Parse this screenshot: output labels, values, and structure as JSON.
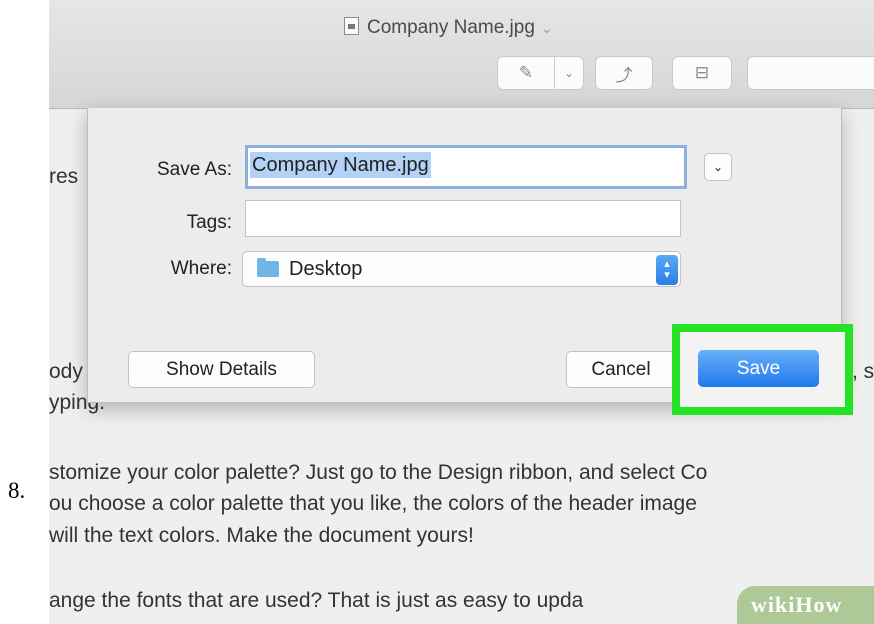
{
  "step_number": "8.",
  "window": {
    "title": "Company Name.jpg",
    "title_chevron": "⌄"
  },
  "toolbar": {
    "markup_icon": "pen-icon",
    "rotate_icon": "rotate-icon",
    "toolbox_icon": "toolbox-icon"
  },
  "document": {
    "fragment_1": "res",
    "fragment_2": "ody",
    "fragment_3": "yping.",
    "fragment_right": ", s",
    "para_lines": [
      "stomize your color palette?  Just go to the Design ribbon, and select Co",
      "ou choose a color palette that you like, the colors of the header image",
      " will the text colors.  Make the document yours!"
    ],
    "last_line": "ange the fonts that are used?  That is just as easy to upda"
  },
  "dialog": {
    "save_as_label": "Save As:",
    "save_as_value": "Company Name.jpg",
    "tags_label": "Tags:",
    "tags_value": "",
    "where_label": "Where:",
    "where_value": "Desktop",
    "show_details_label": "Show Details",
    "cancel_label": "Cancel",
    "save_label": "Save"
  },
  "watermark": {
    "text": "wikiHow"
  },
  "colors": {
    "highlight": "#25e225",
    "save_button": "#2a80ee"
  }
}
